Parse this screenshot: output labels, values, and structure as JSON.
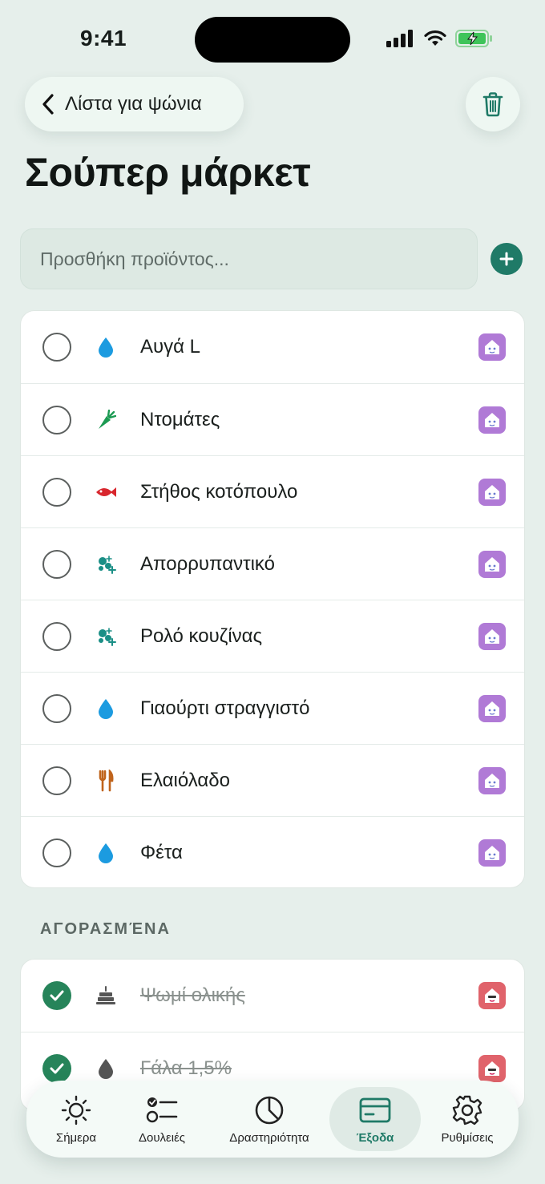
{
  "status_bar": {
    "time": "9:41"
  },
  "header": {
    "back_label": "Λίστα για ψώνια",
    "title": "Σούπερ μάρκετ"
  },
  "add_item": {
    "placeholder": "Προσθήκη προϊόντος..."
  },
  "items": [
    {
      "label": "Αυγά L",
      "category_icon": "water-drop-icon",
      "icon_color": "#1c9be0"
    },
    {
      "label": "Ντομάτες",
      "category_icon": "carrot-icon",
      "icon_color": "#1c9a52"
    },
    {
      "label": "Στήθος κοτόπουλο",
      "category_icon": "fish-icon",
      "icon_color": "#d8262d"
    },
    {
      "label": "Απορρυπαντικό",
      "category_icon": "bubbles-icon",
      "icon_color": "#1b8f86"
    },
    {
      "label": "Ρολό κουζίνας",
      "category_icon": "bubbles-icon",
      "icon_color": "#1b8f86"
    },
    {
      "label": "Γιαούρτι στραγγιστό",
      "category_icon": "water-drop-icon",
      "icon_color": "#1c9be0"
    },
    {
      "label": "Ελαιόλαδο",
      "category_icon": "fork-knife-icon",
      "icon_color": "#c0641c"
    },
    {
      "label": "Φέτα",
      "category_icon": "water-drop-icon",
      "icon_color": "#1c9be0"
    }
  ],
  "member_badge_color": "#b07ad6",
  "bought_section": {
    "title": "ΑΓΟΡΑΣΜΈΝΑ",
    "items": [
      {
        "label": "Ψωμί ολικής",
        "category_icon": "cake-icon",
        "icon_color": "#555",
        "checked": true
      },
      {
        "label": "Γάλα 1,5%",
        "category_icon": "water-drop-icon",
        "icon_color": "#555",
        "checked": true
      }
    ],
    "badge_color": "#e0636b"
  },
  "accent_color": "#1f7a67",
  "tabs": [
    {
      "label": "Σήμερα",
      "icon": "sun-icon"
    },
    {
      "label": "Δουλειές",
      "icon": "checklist-icon"
    },
    {
      "label": "Δραστηριότητα",
      "icon": "pie-chart-icon"
    },
    {
      "label": "Έξοδα",
      "icon": "card-icon",
      "active": true
    },
    {
      "label": "Ρυθμίσεις",
      "icon": "gear-icon"
    }
  ]
}
